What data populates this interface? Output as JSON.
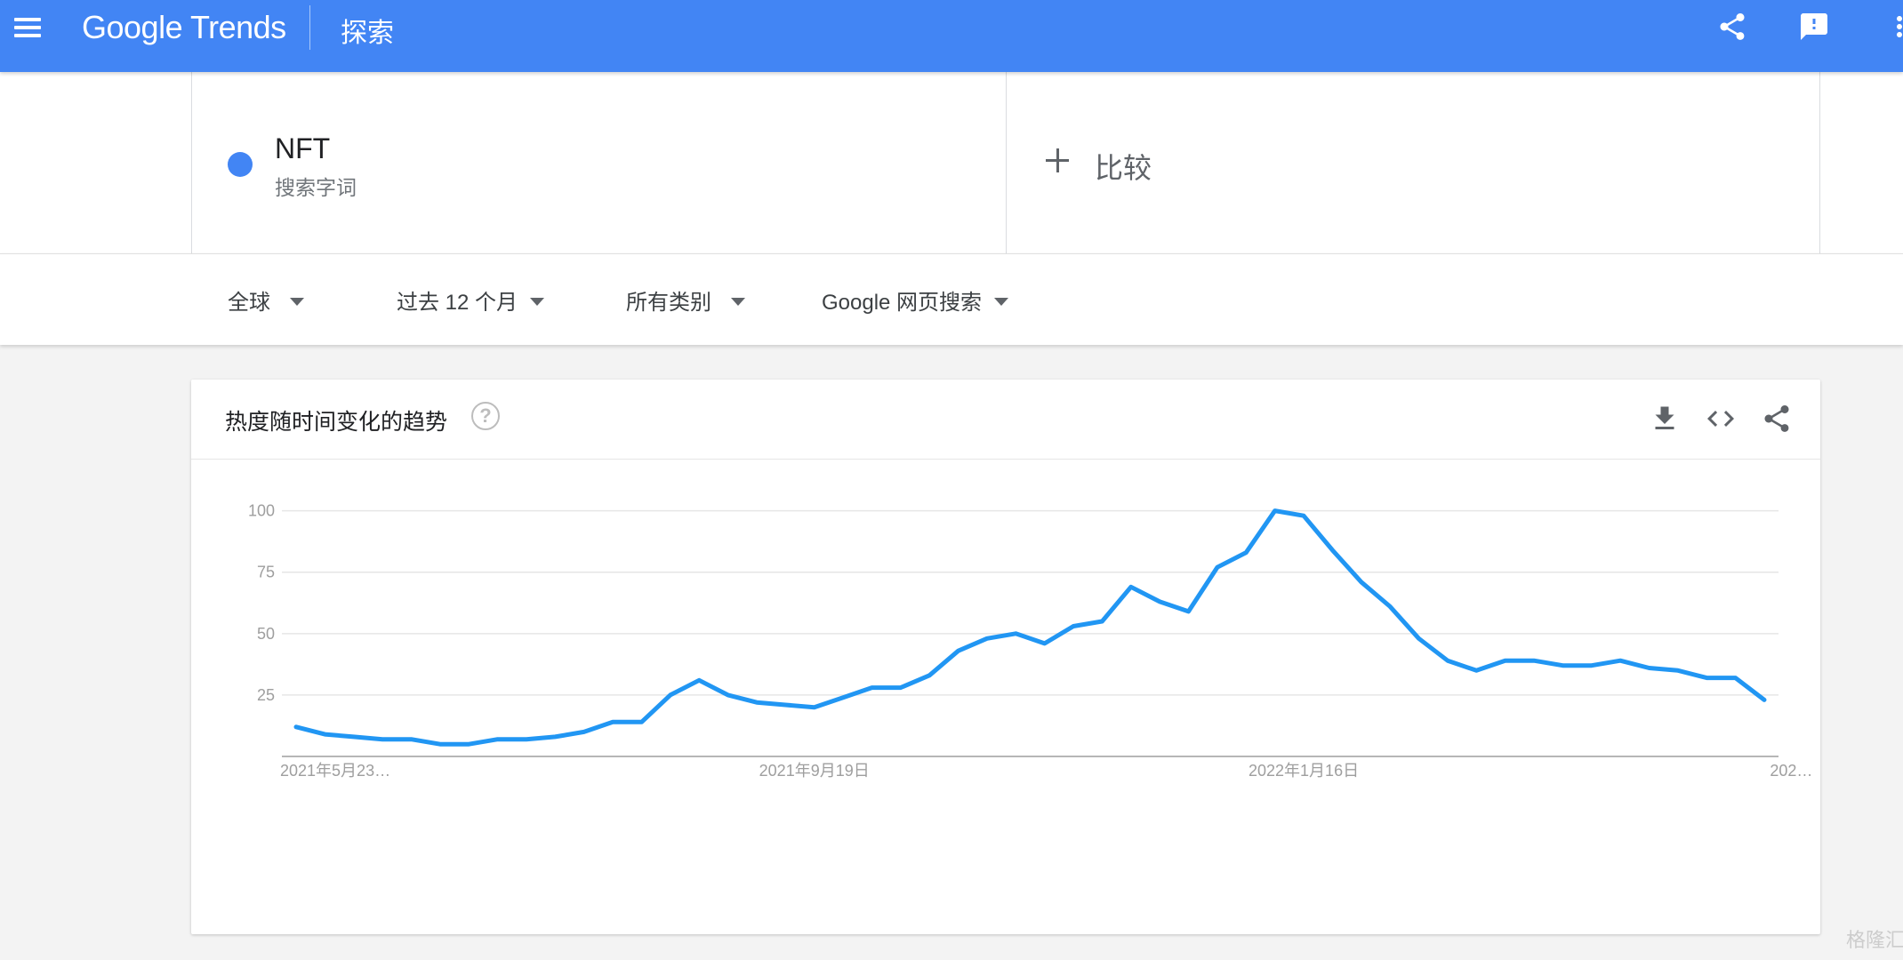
{
  "appbar": {
    "logo_text": "Google Trends",
    "page_title": "探索"
  },
  "search_term": {
    "name": "NFT",
    "type": "搜索字词",
    "color": "#4285f4"
  },
  "compare": {
    "label": "比较"
  },
  "filters": [
    {
      "label": "全球"
    },
    {
      "label": "过去 12 个月"
    },
    {
      "label": "所有类别"
    },
    {
      "label": "Google 网页搜索"
    }
  ],
  "card": {
    "title": "热度随时间变化的趋势"
  },
  "icons": {
    "menu": "menu-icon",
    "share": "share-icon",
    "feedback": "feedback-icon",
    "more": "more-vert-icon",
    "help": "help-icon",
    "download": "download-icon",
    "embed": "embed-code-icon",
    "card_share": "share-icon"
  },
  "colors": {
    "appbar": "#4285f4",
    "series": "#2196f3"
  },
  "watermark": {
    "text": "格隆汇"
  },
  "chart_data": {
    "type": "line",
    "yticks": [
      25,
      50,
      75,
      100
    ],
    "ylim": [
      0,
      100
    ],
    "xtick_labels": [
      "2021年5月23…",
      "2021年9月19日",
      "2022年1月16日",
      "202…"
    ],
    "xtick_index": [
      0,
      18,
      35,
      52
    ],
    "grid": true,
    "series": [
      {
        "values": [
          12,
          9,
          8,
          7,
          7,
          5,
          5,
          7,
          7,
          8,
          10,
          14,
          14,
          25,
          31,
          25,
          22,
          21,
          20,
          24,
          28,
          28,
          33,
          43,
          48,
          50,
          46,
          53,
          55,
          69,
          63,
          59,
          77,
          83,
          100,
          98,
          84,
          71,
          61,
          48,
          39,
          35,
          39,
          39,
          37,
          37,
          39,
          36,
          35,
          32,
          32,
          23
        ]
      }
    ]
  }
}
